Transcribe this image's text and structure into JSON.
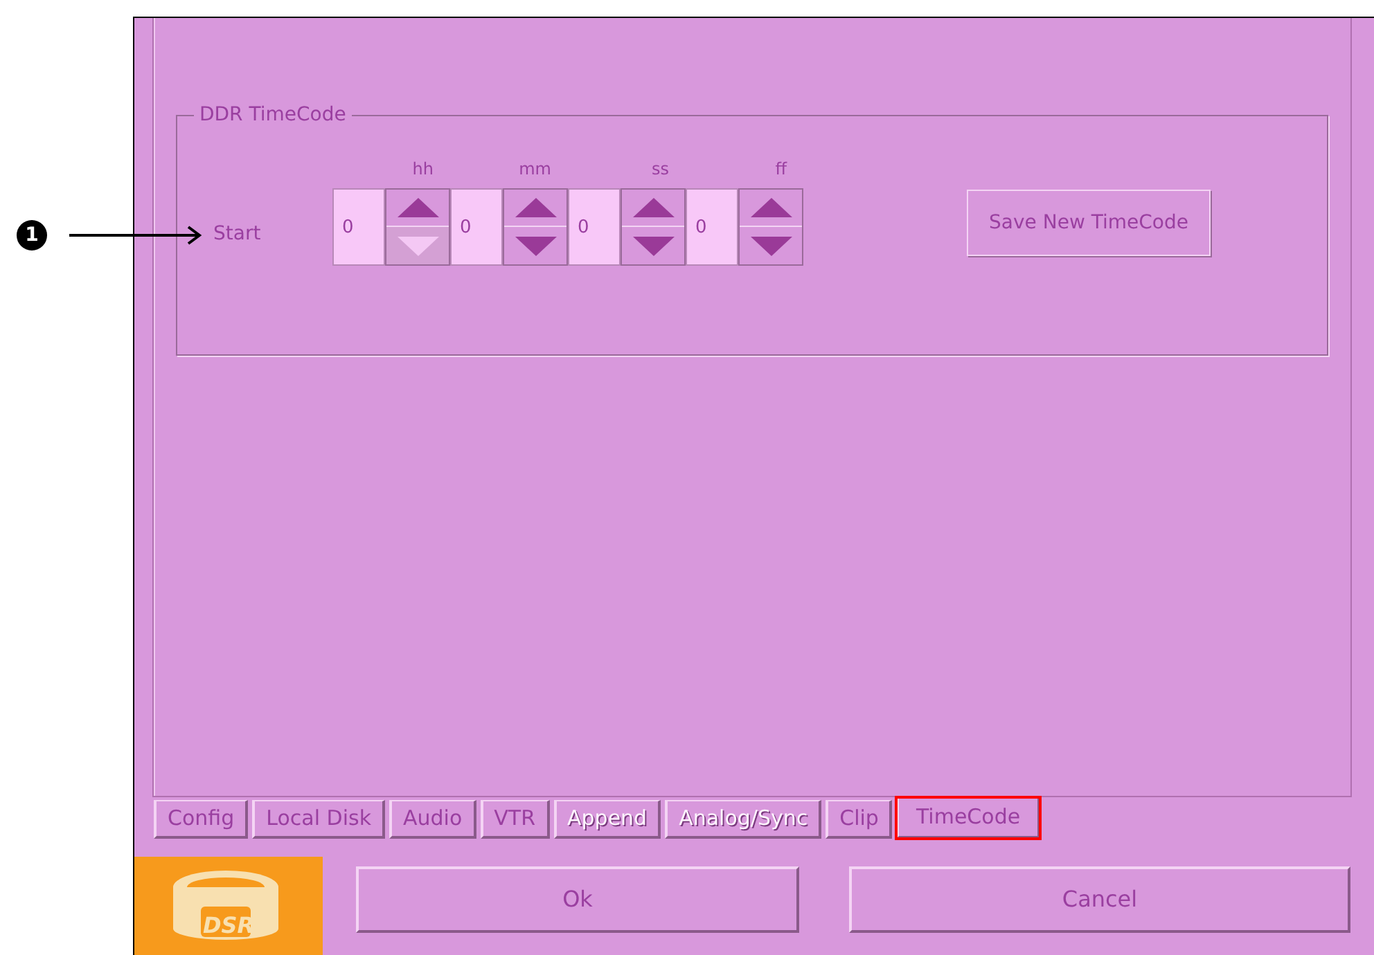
{
  "callout": {
    "label": "1"
  },
  "group": {
    "title": "DDR TimeCode",
    "row_label": "Start",
    "fields": [
      {
        "label": "hh",
        "value": "0",
        "down_disabled": true
      },
      {
        "label": "mm",
        "value": "0",
        "down_disabled": false
      },
      {
        "label": "ss",
        "value": "0",
        "down_disabled": false
      },
      {
        "label": "ff",
        "value": "0",
        "down_disabled": false
      }
    ],
    "save_button": "Save New TimeCode"
  },
  "tabs": [
    {
      "label": "Config",
      "selected": false,
      "disabled": false,
      "highlighted": false
    },
    {
      "label": "Local Disk",
      "selected": false,
      "disabled": false,
      "highlighted": false
    },
    {
      "label": "Audio",
      "selected": false,
      "disabled": false,
      "highlighted": false
    },
    {
      "label": "VTR",
      "selected": false,
      "disabled": false,
      "highlighted": false
    },
    {
      "label": "Append",
      "selected": false,
      "disabled": true,
      "highlighted": false
    },
    {
      "label": "Analog/Sync",
      "selected": false,
      "disabled": true,
      "highlighted": false
    },
    {
      "label": "Clip",
      "selected": false,
      "disabled": false,
      "highlighted": false
    },
    {
      "label": "TimeCode",
      "selected": true,
      "disabled": false,
      "highlighted": true
    }
  ],
  "logo": {
    "text": "DSR"
  },
  "buttons": [
    "Ok",
    "Cancel"
  ]
}
